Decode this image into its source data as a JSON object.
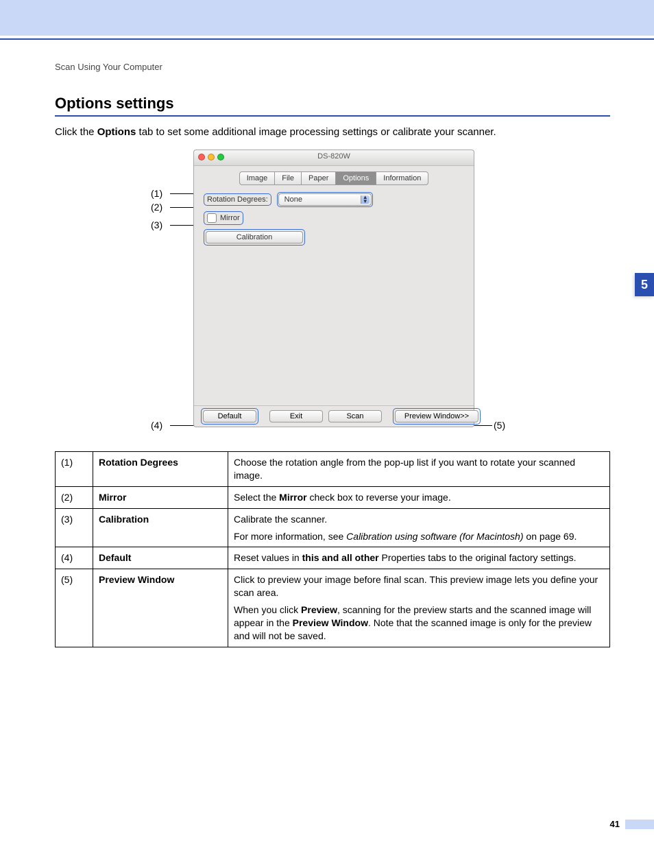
{
  "breadcrumb": "Scan Using Your Computer",
  "section_title": "Options settings",
  "intro_pre": "Click the ",
  "intro_bold": "Options",
  "intro_post": " tab to set some additional image processing settings or calibrate your scanner.",
  "chapter_number": "5",
  "page_number": "41",
  "annotations": {
    "a1": "(1)",
    "a2": "(2)",
    "a3": "(3)",
    "a4": "(4)",
    "a5": "(5)"
  },
  "window": {
    "title": "DS-820W",
    "tabs": {
      "image": "Image",
      "file": "File",
      "paper": "Paper",
      "options": "Options",
      "information": "Information"
    },
    "rotation_label": "Rotation Degrees:",
    "rotation_value": "None",
    "mirror_label": "Mirror",
    "calibration_label": "Calibration",
    "default_btn": "Default",
    "exit_btn": "Exit",
    "scan_btn": "Scan",
    "preview_btn": "Preview Window>>"
  },
  "rows": {
    "r1": {
      "n": "(1)",
      "k": "Rotation Degrees",
      "d": "Choose the rotation angle from the pop-up list if you want to rotate your scanned image."
    },
    "r2": {
      "n": "(2)",
      "k": "Mirror",
      "d_pre": "Select the ",
      "d_b": "Mirror",
      "d_post": " check box to reverse your image."
    },
    "r3": {
      "n": "(3)",
      "k": "Calibration",
      "p1": "Calibrate the scanner.",
      "p2_pre": "For more information, see ",
      "p2_i": "Calibration using software (for Macintosh)",
      "p2_post": " on page 69."
    },
    "r4": {
      "n": "(4)",
      "k": "Default",
      "d_pre": "Reset values in ",
      "d_b": "this and all other",
      "d_post": " Properties tabs to the original factory settings."
    },
    "r5": {
      "n": "(5)",
      "k": "Preview Window",
      "p1": "Click to preview your image before final scan. This preview image lets you define your scan area.",
      "p2_a": "When you click ",
      "p2_b": "Preview",
      "p2_c": ", scanning for the preview starts and the scanned image will appear in the ",
      "p2_d": "Preview Window",
      "p2_e": ". Note that the scanned image is only for the preview and will not be saved."
    }
  }
}
